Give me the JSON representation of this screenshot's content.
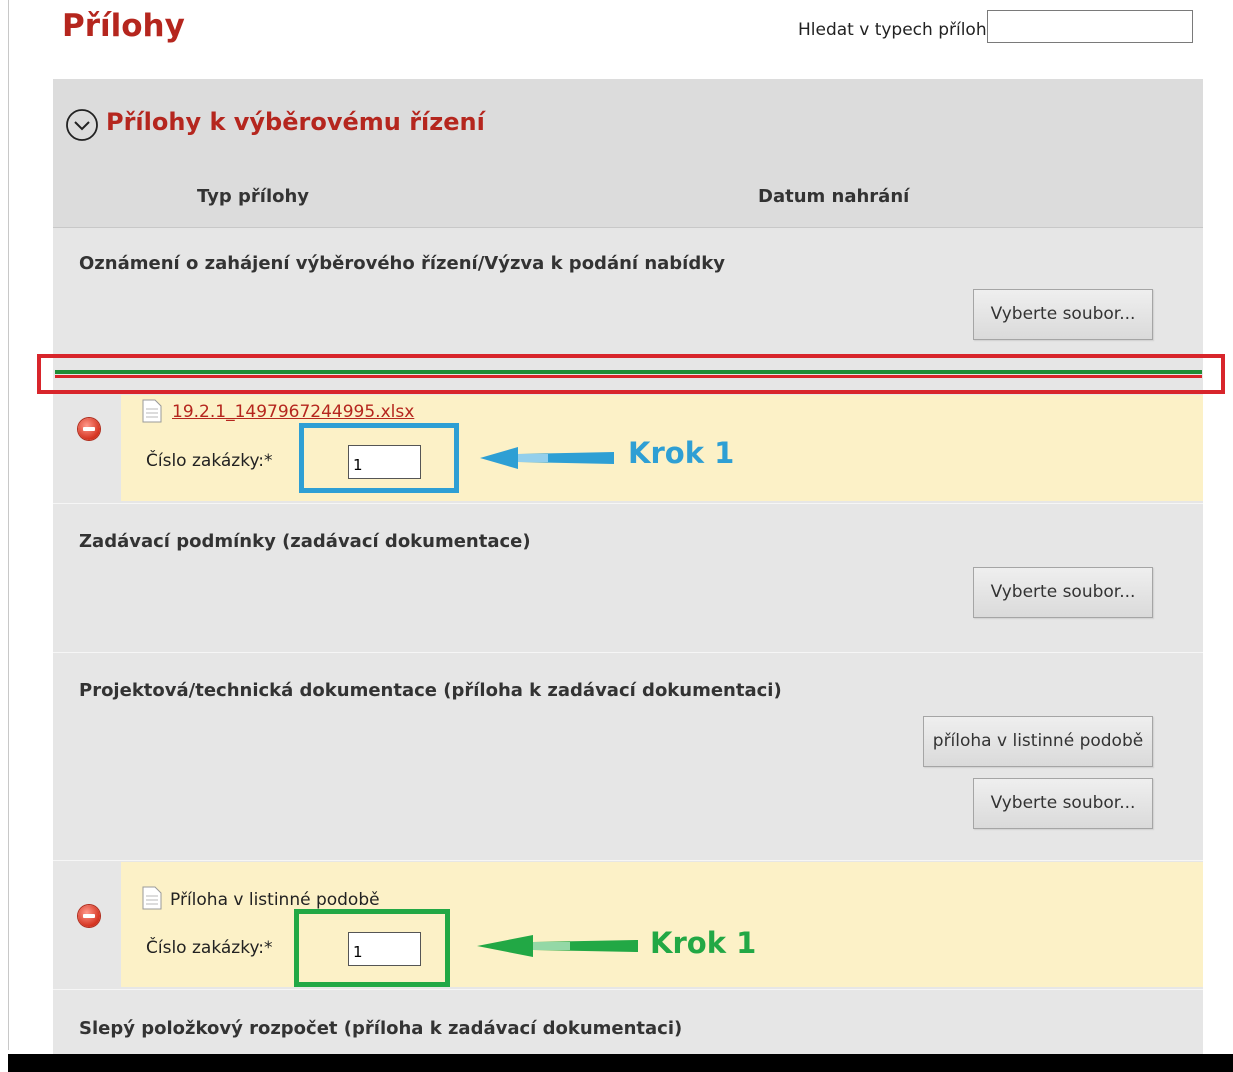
{
  "header": {
    "title": "Přílohy",
    "search_label": "Hledat v typech příloh:",
    "search_value": ""
  },
  "section": {
    "title": "Přílohy k výběrovému řízení",
    "columns": [
      "Typ přílohy",
      "Datum nahrání"
    ]
  },
  "rows": [
    {
      "title": "Oznámení o zahájení výběrového řízení/Výzva k podání nabídky",
      "button": "Vyberte soubor..."
    },
    {
      "title": "Zadávací podmínky (zadávací dokumentace)",
      "button": "Vyberte soubor..."
    },
    {
      "title": "Projektová/technická dokumentace (příloha k zadávací dokumentaci)",
      "paper_button": "příloha v listinné podobě",
      "button": "Vyberte soubor..."
    },
    {
      "title": "Slepý položkový rozpočet (příloha k zadávací dokumentaci)"
    }
  ],
  "attachments": [
    {
      "file_name": "19.2.1_1497967244995.xlsx",
      "field_label": "Číslo zakázky:*",
      "field_value": "1"
    },
    {
      "file_name": "Příloha v listinné podobě",
      "field_label": "Číslo zakázky:*",
      "field_value": "1"
    }
  ],
  "annotations": [
    {
      "label": "Krok 1",
      "color": "#2e9fd4"
    },
    {
      "label": "Krok 1",
      "color": "#22a845"
    }
  ],
  "colors": {
    "accent": "#b5261e",
    "highlight_red": "#d8252b",
    "highlight_green": "#1f8c35",
    "attachment_bg": "#fcf1c7",
    "panel_bg": "#e6e6e6"
  },
  "icons": [
    "collapse-circle-icon",
    "remove-icon",
    "file-icon",
    "arrow-left-icon"
  ]
}
